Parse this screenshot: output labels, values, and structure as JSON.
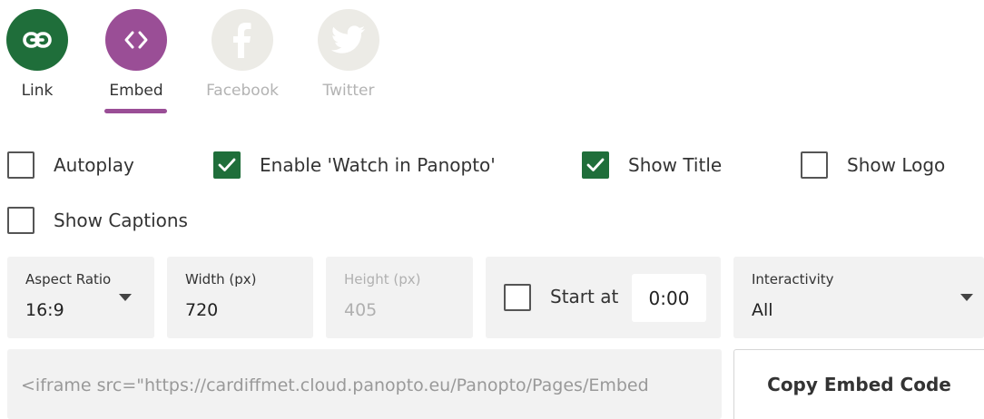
{
  "share_tabs": [
    {
      "label": "Link",
      "icon": "link-icon",
      "state": "enabled",
      "color": "#1f6e3a"
    },
    {
      "label": "Embed",
      "icon": "embed-code-icon",
      "state": "selected",
      "color": "#9a4e96"
    },
    {
      "label": "Facebook",
      "icon": "facebook-icon",
      "state": "disabled",
      "color": "#ecebe6"
    },
    {
      "label": "Twitter",
      "icon": "twitter-icon",
      "state": "disabled",
      "color": "#ecebe6"
    }
  ],
  "options": {
    "autoplay": {
      "label": "Autoplay",
      "checked": false
    },
    "watch_in_panopto": {
      "label": "Enable 'Watch in Panopto'",
      "checked": true
    },
    "show_title": {
      "label": "Show Title",
      "checked": true
    },
    "show_logo": {
      "label": "Show Logo",
      "checked": false
    },
    "show_captions": {
      "label": "Show Captions",
      "checked": false
    }
  },
  "settings": {
    "aspect_ratio": {
      "label": "Aspect Ratio",
      "value": "16:9"
    },
    "width": {
      "label": "Width (px)",
      "value": "720"
    },
    "height": {
      "label": "Height (px)",
      "value": "405"
    },
    "start_at": {
      "label": "Start at",
      "value": "0:00",
      "checked": false
    },
    "interactivity": {
      "label": "Interactivity",
      "value": "All"
    }
  },
  "embed": {
    "code": "<iframe src=\"https://cardiffmet.cloud.panopto.eu/Panopto/Pages/Embed",
    "copy_label": "Copy Embed Code"
  },
  "colors": {
    "accent_green": "#1f6e3a",
    "accent_purple": "#9a4e96",
    "panel_bg": "#f2f2f2"
  }
}
